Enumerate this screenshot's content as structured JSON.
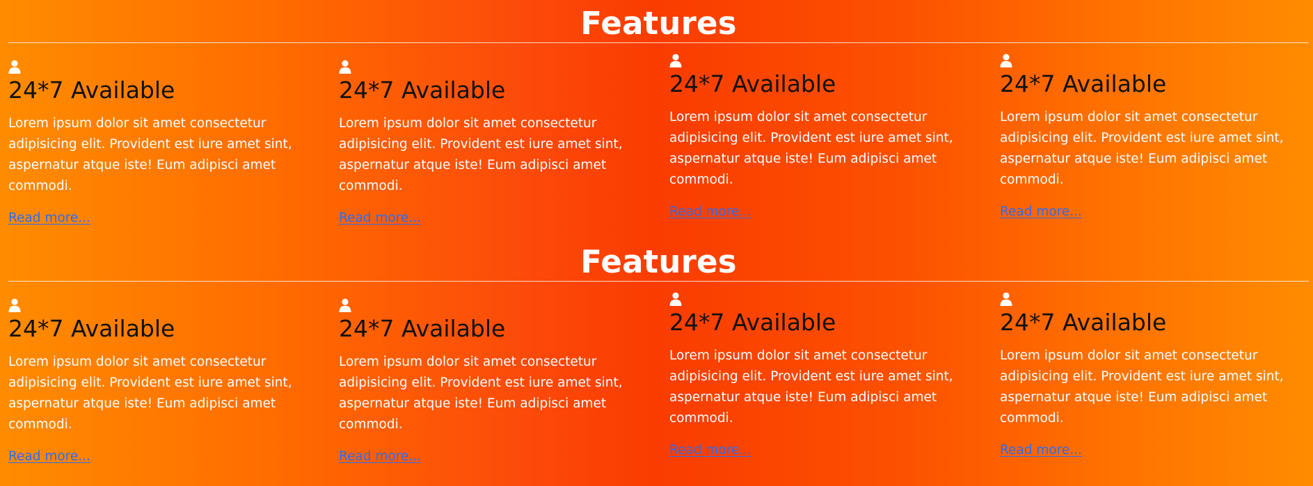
{
  "sections": [
    {
      "title": "Features",
      "cards": [
        {
          "icon": "user-icon",
          "title": "24*7 Available",
          "text": "Lorem ipsum dolor sit amet consectetur adipisicing elit. Provident est iure amet sint, aspernatur atque iste! Eum adipisci amet commodi.",
          "link": "Read more..."
        },
        {
          "icon": "user-icon",
          "title": "24*7 Available",
          "text": "Lorem ipsum dolor sit amet consectetur adipisicing elit. Provident est iure amet sint, aspernatur atque iste! Eum adipisci amet commodi.",
          "link": "Read more..."
        },
        {
          "icon": "user-icon",
          "title": "24*7 Available",
          "text": "Lorem ipsum dolor sit amet consectetur adipisicing elit. Provident est iure amet sint, aspernatur atque iste! Eum adipisci amet commodi.",
          "link": "Read more..."
        },
        {
          "icon": "user-icon",
          "title": "24*7 Available",
          "text": "Lorem ipsum dolor sit amet consectetur adipisicing elit. Provident est iure amet sint, aspernatur atque iste! Eum adipisci amet commodi.",
          "link": "Read more..."
        }
      ]
    },
    {
      "title": "Features",
      "cards": [
        {
          "icon": "user-icon",
          "title": "24*7 Available",
          "text": "Lorem ipsum dolor sit amet consectetur adipisicing elit. Provident est iure amet sint, aspernatur atque iste! Eum adipisci amet commodi.",
          "link": "Read more..."
        },
        {
          "icon": "user-icon",
          "title": "24*7 Available",
          "text": "Lorem ipsum dolor sit amet consectetur adipisicing elit. Provident est iure amet sint, aspernatur atque iste! Eum adipisci amet commodi.",
          "link": "Read more..."
        },
        {
          "icon": "user-icon",
          "title": "24*7 Available",
          "text": "Lorem ipsum dolor sit amet consectetur adipisicing elit. Provident est iure amet sint, aspernatur atque iste! Eum adipisci amet commodi.",
          "link": "Read more..."
        },
        {
          "icon": "user-icon",
          "title": "24*7 Available",
          "text": "Lorem ipsum dolor sit amet consectetur adipisicing elit. Provident est iure amet sint, aspernatur atque iste! Eum adipisci amet commodi.",
          "link": "Read more..."
        }
      ]
    }
  ],
  "colors": {
    "gradient_edge": "#ff8c00",
    "gradient_center": "#fa3c00",
    "title_text": "#ffffff",
    "card_title": "#111111",
    "body_text": "#ffffff",
    "link": "#2a6df2"
  }
}
